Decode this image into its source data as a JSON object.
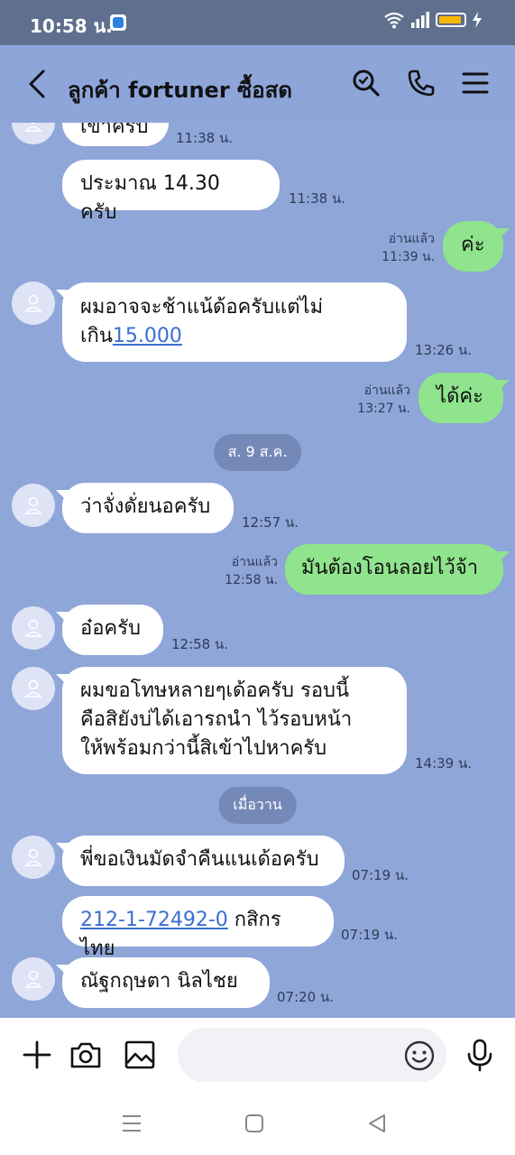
{
  "status_bar": {
    "time": "10:58 น."
  },
  "header": {
    "title": "ลูกค้า fortuner ซื้อสด"
  },
  "messages": {
    "m0": {
      "text": "เข้าครับ",
      "time": "11:38 น."
    },
    "m1": {
      "text": "ประมาณ 14.30 ครับ",
      "time": "11:38 น."
    },
    "m2": {
      "text": "ค่ะ",
      "read": "อ่านแล้ว",
      "time": "11:39 น."
    },
    "m3": {
      "line1": "ผมอาจจะช้าแน้ด้อครับแต่ไม่",
      "line2_prefix": "เกิน",
      "link": "15.000",
      "time": "13:26 น."
    },
    "m4": {
      "text": "ได้ค่ะ",
      "read": "อ่านแล้ว",
      "time": "13:27 น."
    },
    "date1": "ส. 9 ส.ค.",
    "m5": {
      "text": "ว่าจั่งดั่ยนอครับ",
      "time": "12:57 น."
    },
    "m6": {
      "text": "มันต้องโอนลอยไว้จ้า",
      "read": "อ่านแล้ว",
      "time": "12:58 น."
    },
    "m7": {
      "text": "อ๋อครับ",
      "time": "12:58 น."
    },
    "m8": {
      "line1": "ผมขอโทษหลายๆเด้อครับ รอบนี้",
      "line2": "คือสิยังบ่ได้เอารถนำ  ไว้รอบหน้า",
      "line3": "ให้พร้อมกว่านี้สิเข้าไปหาครับ",
      "time": "14:39 น."
    },
    "date2": "เมื่อวาน",
    "m9": {
      "text": "พี่ขอเงินมัดจำคืนแนเด้อครับ",
      "time": "07:19 น."
    },
    "m10": {
      "link": "212-1-72492-0",
      "suffix": " กสิกรไทย",
      "time": "07:19 น."
    },
    "m11": {
      "text": "ณัฐกฤษตา นิลไชย",
      "time": "07:20 น."
    }
  },
  "icons": {
    "status": [
      "app-notification-icon",
      "wifi-icon",
      "signal-icon",
      "battery-icon",
      "charging-icon"
    ],
    "header": [
      "back-icon",
      "search-icon",
      "phone-icon",
      "menu-icon"
    ],
    "input": [
      "plus-icon",
      "camera-icon",
      "image-icon",
      "emoji-icon",
      "microphone-icon"
    ],
    "nav": [
      "recents-icon",
      "home-icon",
      "back-nav-icon"
    ]
  },
  "colors": {
    "chat_bg": "#8fa6d8",
    "outgoing_bubble": "#8fe48d",
    "link": "#3b6fd3",
    "status_bar": "#5f6f8e"
  }
}
